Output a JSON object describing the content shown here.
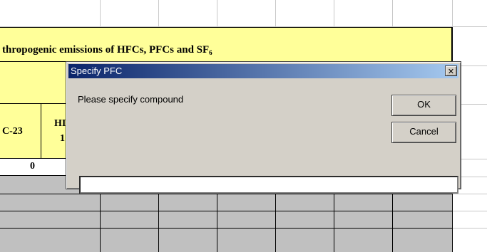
{
  "spreadsheet": {
    "title_prefix": "thropogenic emissions of HFCs, PFCs and SF",
    "title_subscript": "6",
    "col_header_1": "C-23",
    "col_header_2_line1": "HI",
    "col_header_2_line2": "1",
    "first_value": "0"
  },
  "dialog": {
    "title": "Specify PFC",
    "close_label": "✕",
    "prompt": "Please specify compound",
    "ok_label": "OK",
    "cancel_label": "Cancel",
    "input_value": ""
  },
  "colors": {
    "header_fill": "#ffff99",
    "grey_fill": "#c0c0c0",
    "title_bar_start": "#0a246a",
    "title_bar_end": "#a6caf0",
    "dialog_bg": "#d4d0c8"
  }
}
